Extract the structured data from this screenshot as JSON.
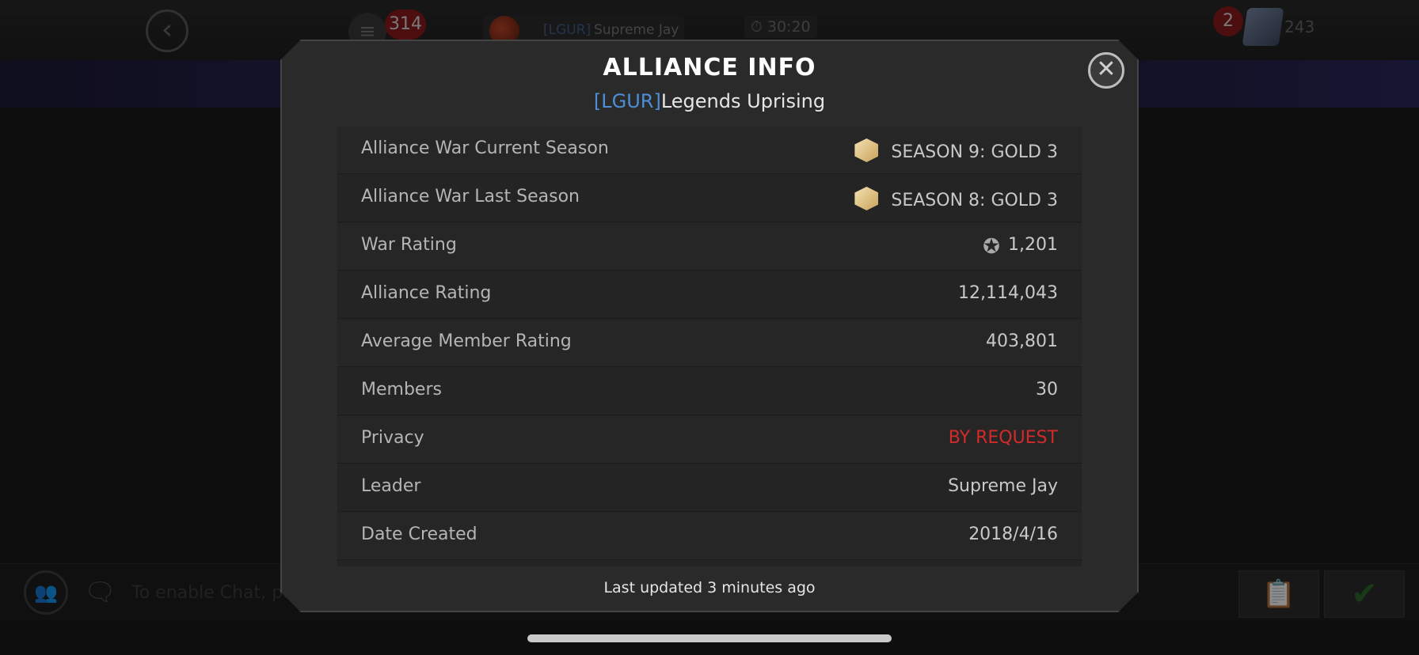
{
  "top_bar": {
    "notification_count": "314",
    "player_tag": "[LGUR]",
    "player_name": "Supreme Jay",
    "timer": "30:20",
    "alert_count": "2",
    "unit_count": "243"
  },
  "bottom_bar": {
    "chat_placeholder": "To enable Chat, ple"
  },
  "modal": {
    "title": "ALLIANCE INFO",
    "alliance_tag": "[LGUR]",
    "alliance_name": "Legends Uprising",
    "footer": "Last updated 3 minutes ago",
    "rows": [
      {
        "label": "Alliance War Current Season",
        "value": "SEASON 9: GOLD 3",
        "icon": "gold-tier-icon"
      },
      {
        "label": "Alliance War Last Season",
        "value": "SEASON 8: GOLD 3",
        "icon": "gold-tier-icon"
      },
      {
        "label": "War Rating",
        "value": "1,201",
        "icon": "war-rating-icon"
      },
      {
        "label": "Alliance Rating",
        "value": "12,114,043"
      },
      {
        "label": "Average Member Rating",
        "value": "403,801"
      },
      {
        "label": "Members",
        "value": "30"
      },
      {
        "label": "Privacy",
        "value": "BY REQUEST",
        "color": "#d42a2a"
      },
      {
        "label": "Leader",
        "value": "Supreme Jay"
      },
      {
        "label": "Date Created",
        "value": "2018/4/16"
      }
    ]
  }
}
